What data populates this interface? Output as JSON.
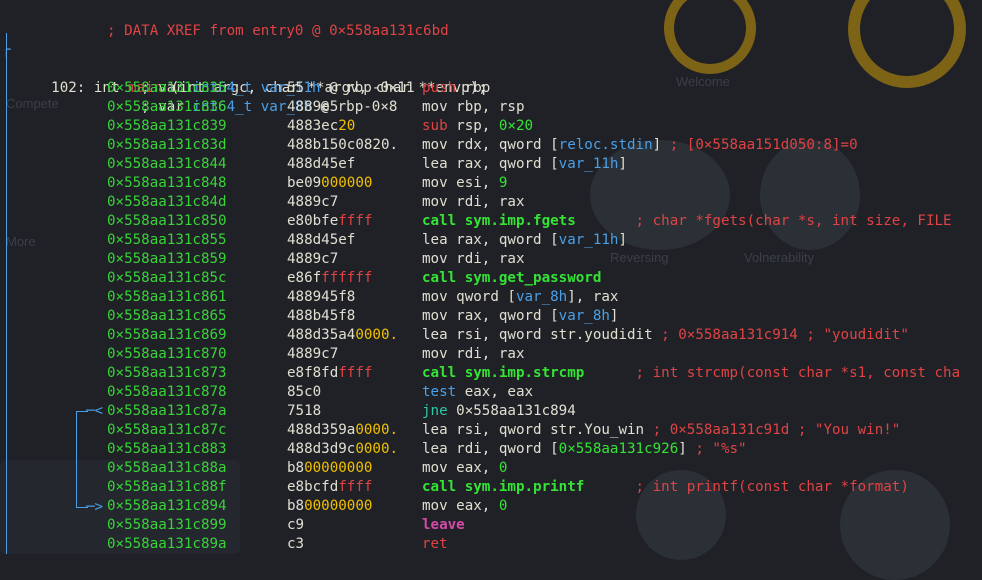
{
  "header": {
    "xref": "; DATA XREF from entry0 @ 0×558aa131c6bd",
    "signature_prefix": "102: int ",
    "signature_name": "main",
    "signature_args": " (int argc, char **argv, char **envp);",
    "var1_prefix": "; var ",
    "var1_type": "int64_t",
    "var1_name": "var_11h",
    "var1_loc": " @ rbp-0×11",
    "var2_prefix": "; var ",
    "var2_type": "int64_t",
    "var2_name": "var_8h",
    "var2_loc": " @ rbp-0×8"
  },
  "background": {
    "labels": [
      "Compete",
      "More",
      "Welcome",
      "Reversing",
      "Volnerability"
    ]
  },
  "rows": [
    {
      "addr": "0×558aa131c835",
      "b1": "55",
      "b2": "",
      "b3": "",
      "mn": "push",
      "mnc": "mn-stack",
      "o1": " rbp",
      "o2": "",
      "o3": "",
      "o4": "",
      "o5": "",
      "cm": ""
    },
    {
      "addr": "0×558aa131c836",
      "b1": "4889e5",
      "b2": "",
      "b3": "",
      "mn": "mov",
      "mnc": "mn-std",
      "o1": " rbp, rsp",
      "o2": "",
      "o3": "",
      "o4": "",
      "o5": "",
      "cm": ""
    },
    {
      "addr": "0×558aa131c839",
      "b1": "4883ec",
      "b2": "",
      "b3": "20",
      "mn": "sub",
      "mnc": "mn-stack",
      "o1": " rsp, ",
      "o2": "",
      "o3": "0×20",
      "o4": "",
      "o5": "",
      "cm": ""
    },
    {
      "addr": "0×558aa131c83d",
      "b1": "488b150c0820.",
      "b2": "",
      "b3": "",
      "mn": "mov",
      "mnc": "mn-std",
      "o1": " rdx, qword [",
      "o2": "reloc.stdin",
      "o3": "",
      "o4": "]",
      "o5": "",
      "cm": " ; [0×558aa151d050:8]=0"
    },
    {
      "addr": "0×558aa131c844",
      "b1": "488d45ef",
      "b2": "",
      "b3": "",
      "mn": "lea",
      "mnc": "mn-std",
      "o1": " rax, qword [",
      "o2": "var_11h",
      "o3": "",
      "o4": "]",
      "o5": "",
      "cm": ""
    },
    {
      "addr": "0×558aa131c848",
      "b1": "be09",
      "b2": "",
      "b3": "000000",
      "mn": "mov",
      "mnc": "mn-std",
      "o1": " esi, ",
      "o2": "",
      "o3": "9",
      "o4": "",
      "o5": "",
      "cm": ""
    },
    {
      "addr": "0×558aa131c84d",
      "b1": "4889c7",
      "b2": "",
      "b3": "",
      "mn": "mov",
      "mnc": "mn-std",
      "o1": " rdi, rax",
      "o2": "",
      "o3": "",
      "o4": "",
      "o5": "",
      "cm": ""
    },
    {
      "addr": "0×558aa131c850",
      "b1": "e80bfe",
      "b2": "ffff",
      "b3": "",
      "mn": "call",
      "mnc": "mn-call",
      "o1": "",
      "o2": "",
      "o3": "",
      "o4": "",
      "o5": " sym.imp.fgets",
      "cm": "       ; char *fgets(char *s, int size, FILE"
    },
    {
      "addr": "0×558aa131c855",
      "b1": "488d45ef",
      "b2": "",
      "b3": "",
      "mn": "lea",
      "mnc": "mn-std",
      "o1": " rax, qword [",
      "o2": "var_11h",
      "o3": "",
      "o4": "]",
      "o5": "",
      "cm": ""
    },
    {
      "addr": "0×558aa131c859",
      "b1": "4889c7",
      "b2": "",
      "b3": "",
      "mn": "mov",
      "mnc": "mn-std",
      "o1": " rdi, rax",
      "o2": "",
      "o3": "",
      "o4": "",
      "o5": "",
      "cm": ""
    },
    {
      "addr": "0×558aa131c85c",
      "b1": "e86f",
      "b2": "ffffff",
      "b3": "",
      "mn": "call",
      "mnc": "mn-call",
      "o1": "",
      "o2": "",
      "o3": "",
      "o4": "",
      "o5": " sym.get_password",
      "cm": ""
    },
    {
      "addr": "0×558aa131c861",
      "b1": "488945f8",
      "b2": "",
      "b3": "",
      "mn": "mov",
      "mnc": "mn-std",
      "o1": " qword [",
      "o2": "var_8h",
      "o3": "",
      "o4": "], rax",
      "o5": "",
      "cm": ""
    },
    {
      "addr": "0×558aa131c865",
      "b1": "488b45f8",
      "b2": "",
      "b3": "",
      "mn": "mov",
      "mnc": "mn-std",
      "o1": " rax, qword [",
      "o2": "var_8h",
      "o3": "",
      "o4": "]",
      "o5": "",
      "cm": ""
    },
    {
      "addr": "0×558aa131c869",
      "b1": "488d35a4",
      "b2": "",
      "b3": "0000.",
      "mn": "lea",
      "mnc": "mn-std",
      "o1": " rsi, qword str.youdidit",
      "o2": "",
      "o3": "",
      "o4": "",
      "o5": "",
      "cm": " ; 0×558aa131c914 ; \"youdidit\""
    },
    {
      "addr": "0×558aa131c870",
      "b1": "4889c7",
      "b2": "",
      "b3": "",
      "mn": "mov",
      "mnc": "mn-std",
      "o1": " rdi, rax",
      "o2": "",
      "o3": "",
      "o4": "",
      "o5": "",
      "cm": ""
    },
    {
      "addr": "0×558aa131c873",
      "b1": "e8f8fd",
      "b2": "ffff",
      "b3": "",
      "mn": "call",
      "mnc": "mn-call",
      "o1": "",
      "o2": "",
      "o3": "",
      "o4": "",
      "o5": " sym.imp.strcmp",
      "cm": "      ; int strcmp(const char *s1, const cha"
    },
    {
      "addr": "0×558aa131c878",
      "b1": "85c0",
      "b2": "",
      "b3": "",
      "mn": "test",
      "mnc": "mn-test",
      "o1": " eax, eax",
      "o2": "",
      "o3": "",
      "o4": "",
      "o5": "",
      "cm": ""
    },
    {
      "addr": "0×558aa131c87a",
      "b1": "7518",
      "b2": "",
      "b3": "",
      "mn": "jne",
      "mnc": "mn-jmp",
      "o1": " 0×558aa131c894",
      "o2": "",
      "o3": "",
      "o4": "",
      "o5": "",
      "cm": ""
    },
    {
      "addr": "0×558aa131c87c",
      "b1": "488d359a",
      "b2": "",
      "b3": "0000.",
      "mn": "lea",
      "mnc": "mn-std",
      "o1": " rsi, qword str.You_win",
      "o2": "",
      "o3": "",
      "o4": "",
      "o5": "",
      "cm": " ; 0×558aa131c91d ; \"You win!\""
    },
    {
      "addr": "0×558aa131c883",
      "b1": "488d3d9c",
      "b2": "",
      "b3": "0000.",
      "mn": "lea",
      "mnc": "mn-std",
      "o1": " rdi, qword [",
      "o2": "",
      "o3": "0×558aa131c926",
      "o4": "]",
      "o5": "",
      "cm": " ; \"%s\""
    },
    {
      "addr": "0×558aa131c88a",
      "b1": "b8",
      "b2": "",
      "b3": "00000000",
      "mn": "mov",
      "mnc": "mn-std",
      "o1": " eax, ",
      "o2": "",
      "o3": "0",
      "o4": "",
      "o5": "",
      "cm": ""
    },
    {
      "addr": "0×558aa131c88f",
      "b1": "e8bcfd",
      "b2": "ffff",
      "b3": "",
      "mn": "call",
      "mnc": "mn-call",
      "o1": "",
      "o2": "",
      "o3": "",
      "o4": "",
      "o5": " sym.imp.printf",
      "cm": "      ; int printf(const char *format)"
    },
    {
      "addr": "0×558aa131c894",
      "b1": "b8",
      "b2": "",
      "b3": "00000000",
      "mn": "mov",
      "mnc": "mn-std",
      "o1": " eax, ",
      "o2": "",
      "o3": "0",
      "o4": "",
      "o5": "",
      "cm": ""
    },
    {
      "addr": "0×558aa131c899",
      "b1": "c9",
      "b2": "",
      "b3": "",
      "mn": "leave",
      "mnc": "mn-leave",
      "o1": "",
      "o2": "",
      "o3": "",
      "o4": "",
      "o5": "",
      "cm": ""
    },
    {
      "addr": "0×558aa131c89a",
      "b1": "c3",
      "b2": "",
      "b3": "",
      "mn": "ret",
      "mnc": "mn-stack",
      "o1": "",
      "o2": "",
      "o3": "",
      "o4": "",
      "o5": "",
      "cm": ""
    }
  ],
  "flow": {
    "jump_out": "─<",
    "jump_in": "─>",
    "corner": "┌"
  }
}
